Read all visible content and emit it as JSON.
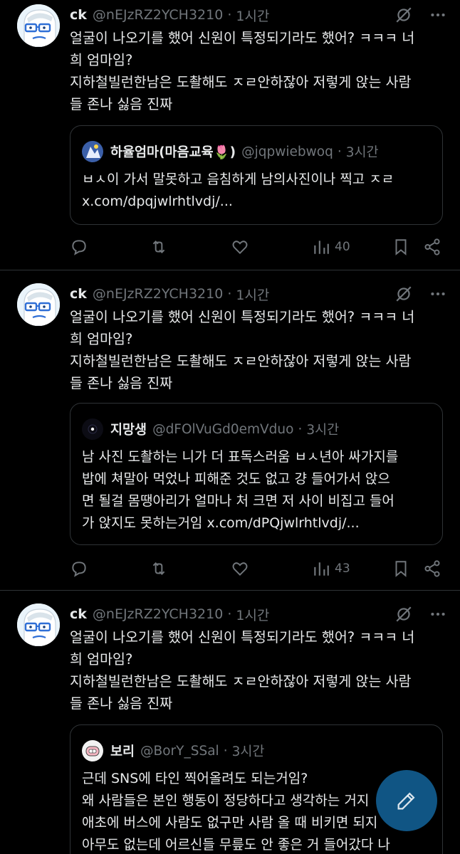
{
  "tweets": [
    {
      "name": "ck",
      "handle": "@nEJzRZ2YCH3210",
      "time": "1시간",
      "lines": [
        "얼굴이 나오기를 했어 신원이 특정되기라도 했어? ㅋㅋㅋ 너",
        "희 엄마임?",
        "지하철빌런한남은 도촬해도 ㅈㄹ안하잖아 저렇게 앉는 사람",
        "들 존나 싫음 진짜"
      ],
      "quote": {
        "name": "하율엄마(마음교육🌷)",
        "handle": "@jqpwiebwoq",
        "time": "3시간",
        "lines": [
          "ㅂㅅ이 가서 말못하고 음침하게 남의사진이나 찍고 ㅈㄹ",
          "x.com/dpqjwlrhtlvdj/..."
        ]
      },
      "views": "40"
    },
    {
      "name": "ck",
      "handle": "@nEJzRZ2YCH3210",
      "time": "1시간",
      "lines": [
        "얼굴이 나오기를 했어 신원이 특정되기라도 했어? ㅋㅋㅋ 너",
        "희 엄마임?",
        "지하철빌런한남은 도촬해도 ㅈㄹ안하잖아 저렇게 앉는 사람",
        "들 존나 싫음 진짜"
      ],
      "quote": {
        "name": "지망생",
        "handle": "@dFOlVuGd0emVduo",
        "time": "3시간",
        "lines": [
          "남 사진 도촬하는 니가 더 표독스러움 ㅂㅅ년아 싸가지를",
          "밥에 쳐말아 먹었나 피해준 것도 없고 걍 들어가서 앉으",
          "면 될걸 몸땡아리가 얼마나 처 크면 저 사이 비집고 들어",
          "가 앉지도 못하는거임 x.com/dPQjwlrhtlvdj/..."
        ]
      },
      "views": "43"
    },
    {
      "name": "ck",
      "handle": "@nEJzRZ2YCH3210",
      "time": "1시간",
      "lines": [
        "얼굴이 나오기를 했어 신원이 특정되기라도 했어? ㅋㅋㅋ 너",
        "희 엄마임?",
        "지하철빌런한남은 도촬해도 ㅈㄹ안하잖아 저렇게 앉는 사람",
        "들 존나 싫음 진짜"
      ],
      "quote": {
        "name": "보리",
        "handle": "@BorY_SSal",
        "time": "3시간",
        "lines": [
          "근데 SNS에 타인 찍어올려도 되는거임?",
          "왜 사람들은 본인 행동이 정당하다고 생각하는 거지",
          "애초에 버스에 사람도 없구만 사람 올 때 비키면 되지",
          "아무도 없는데 어르신들 무릎도 안 좋은 거 들어갔다 나"
        ]
      }
    }
  ],
  "dot": "·",
  "colors": {
    "background": "#000000",
    "text": "#e7e9ea",
    "muted": "#71767b",
    "border": "#2f3336",
    "accent": "#1d9bf0"
  },
  "icons": [
    "grok-icon",
    "more-icon",
    "reply-icon",
    "retweet-icon",
    "like-icon",
    "views-icon",
    "bookmark-icon",
    "share-icon",
    "compose-icon"
  ]
}
